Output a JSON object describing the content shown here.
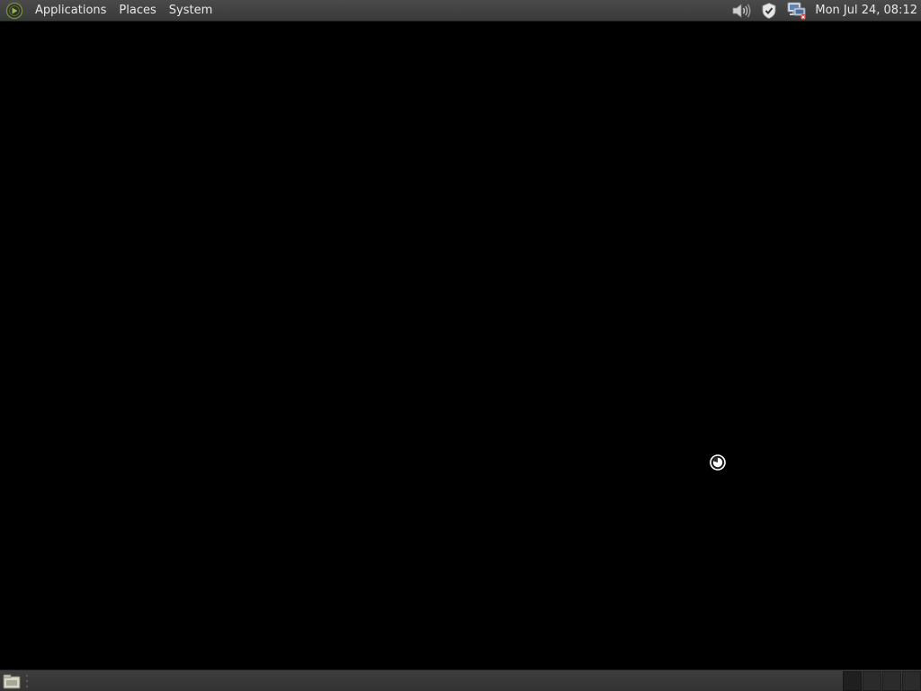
{
  "top_panel": {
    "logo_icon": "distro-logo-icon",
    "menus": [
      {
        "label": "Applications"
      },
      {
        "label": "Places"
      },
      {
        "label": "System"
      }
    ],
    "tray": {
      "volume_icon": "speaker-icon",
      "security_icon": "shield-icon",
      "network_icon": "network-disconnected-icon",
      "clock": "Mon Jul 24, 08:12"
    }
  },
  "desktop": {
    "cursor_icon": "busy-cursor-icon"
  },
  "bottom_panel": {
    "show_desktop_icon": "show-desktop-icon",
    "workspace_count": 4,
    "active_workspace": 1
  },
  "colors": {
    "panel": "#3e3e3e",
    "desktop": "#000000",
    "text": "#e8e8e8",
    "logo_green": "#7a9a3a"
  }
}
